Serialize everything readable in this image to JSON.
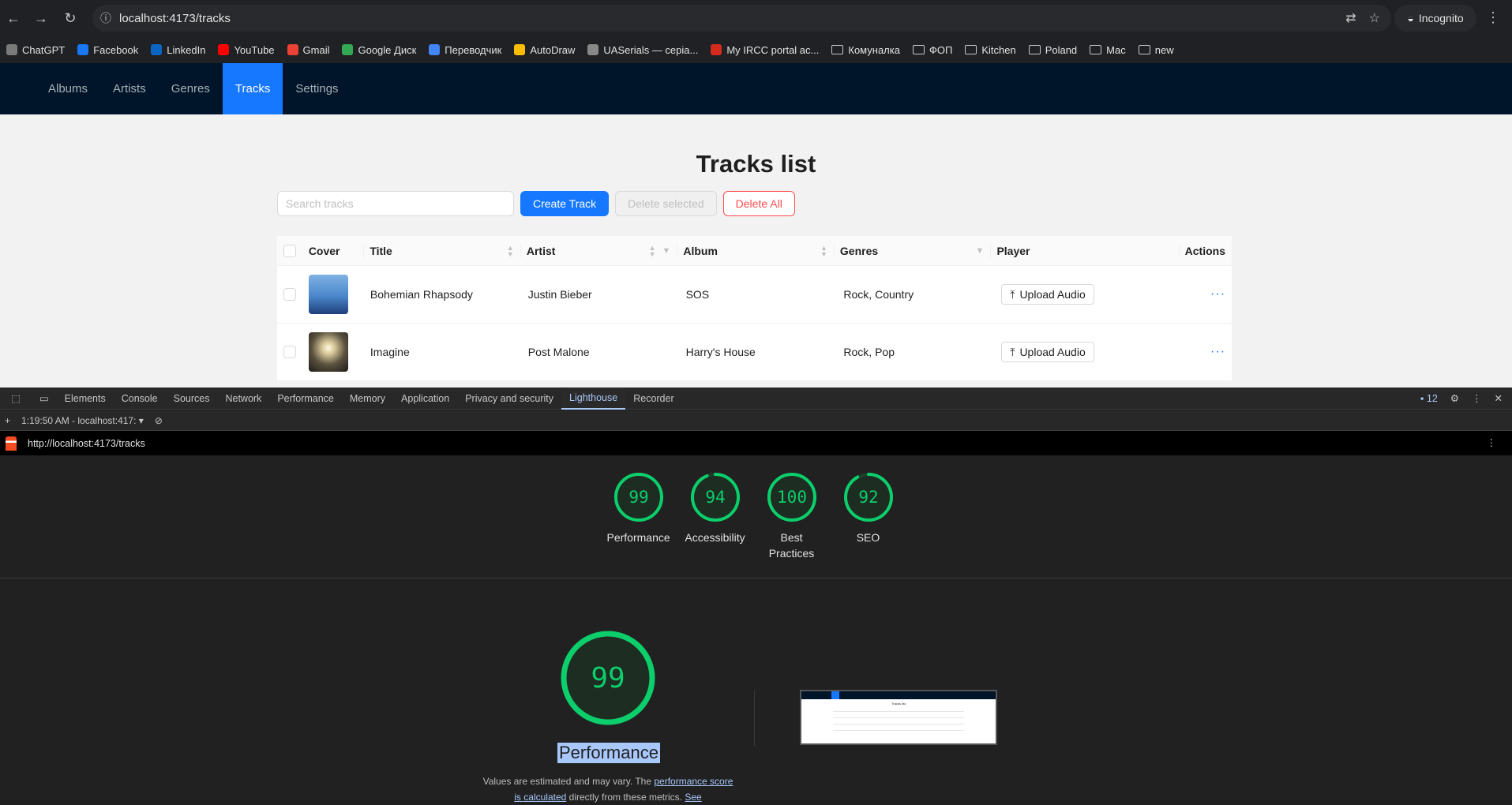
{
  "browser": {
    "url": "localhost:4173/tracks",
    "mode_label": "Incognito",
    "bookmarks": [
      {
        "label": "ChatGPT",
        "color": "#7a7a7a",
        "type": "site"
      },
      {
        "label": "Facebook",
        "color": "#1877f2",
        "type": "site"
      },
      {
        "label": "LinkedIn",
        "color": "#0a66c2",
        "type": "site"
      },
      {
        "label": "YouTube",
        "color": "#ff0000",
        "type": "site"
      },
      {
        "label": "Gmail",
        "color": "#ea4335",
        "type": "site"
      },
      {
        "label": "Google Диск",
        "color": "#34a853",
        "type": "site"
      },
      {
        "label": "Переводчик",
        "color": "#4285f4",
        "type": "site"
      },
      {
        "label": "AutoDraw",
        "color": "#fbbc04",
        "type": "site"
      },
      {
        "label": "UASerials — серіа...",
        "color": "#888888",
        "type": "site"
      },
      {
        "label": "My IRCC portal ac...",
        "color": "#d52b1e",
        "type": "site"
      },
      {
        "label": "Комуналка",
        "type": "folder"
      },
      {
        "label": "ФОП",
        "type": "folder"
      },
      {
        "label": "Kitchen",
        "type": "folder"
      },
      {
        "label": "Poland",
        "type": "folder"
      },
      {
        "label": "Mac",
        "type": "folder"
      },
      {
        "label": "new",
        "type": "folder"
      }
    ]
  },
  "app": {
    "nav": [
      {
        "label": "Albums",
        "active": false
      },
      {
        "label": "Artists",
        "active": false
      },
      {
        "label": "Genres",
        "active": false
      },
      {
        "label": "Tracks",
        "active": true
      },
      {
        "label": "Settings",
        "active": false
      }
    ],
    "title": "Tracks list",
    "search_placeholder": "Search tracks",
    "buttons": {
      "create": "Create Track",
      "delete_selected": "Delete selected",
      "delete_all": "Delete All"
    },
    "columns": {
      "cover": "Cover",
      "title": "Title",
      "artist": "Artist",
      "album": "Album",
      "genres": "Genres",
      "player": "Player",
      "actions": "Actions"
    },
    "upload_label": "Upload Audio",
    "tracks": [
      {
        "title": "Bohemian Rhapsody",
        "artist": "Justin Bieber",
        "album": "SOS",
        "genres": "Rock, Country",
        "cover": "sea"
      },
      {
        "title": "Imagine",
        "artist": "Post Malone",
        "album": "Harry's House",
        "genres": "Rock, Pop",
        "cover": "light"
      }
    ]
  },
  "devtools": {
    "tabs": [
      {
        "label": "Elements",
        "active": false
      },
      {
        "label": "Console",
        "active": false
      },
      {
        "label": "Sources",
        "active": false
      },
      {
        "label": "Network",
        "active": false
      },
      {
        "label": "Performance",
        "active": false
      },
      {
        "label": "Memory",
        "active": false
      },
      {
        "label": "Application",
        "active": false
      },
      {
        "label": "Privacy and security",
        "active": false
      },
      {
        "label": "Lighthouse",
        "active": true
      },
      {
        "label": "Recorder",
        "active": false
      }
    ],
    "issues_count": "12",
    "report_select": "1:19:50 AM - localhost:417:",
    "report_url": "http://localhost:4173/tracks",
    "scores": [
      {
        "label": "Performance",
        "value": 99
      },
      {
        "label": "Accessibility",
        "value": 94
      },
      {
        "label": "Best Practices",
        "value": 100
      },
      {
        "label": "SEO",
        "value": 92
      }
    ],
    "score_color": "#0cce6b",
    "main_score": {
      "value": 99,
      "label": "Performance"
    },
    "note": {
      "pre": "Values are estimated and may vary. The ",
      "link": "performance score is calculated",
      "post": " directly from these metrics. ",
      "see": "See"
    }
  }
}
